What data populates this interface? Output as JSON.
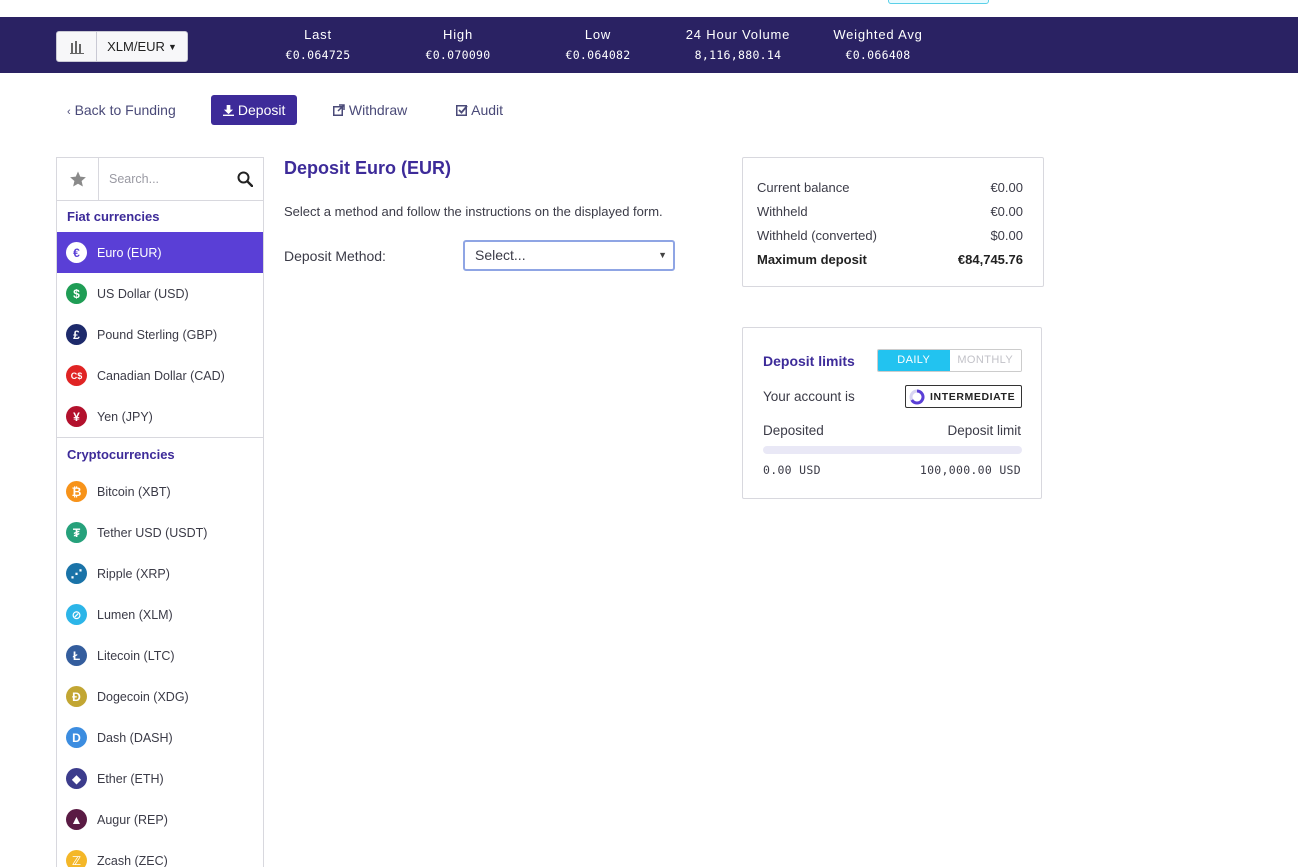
{
  "ticker": {
    "pair": "XLM/EUR",
    "stats": [
      {
        "label": "Last",
        "value": "€0.064725"
      },
      {
        "label": "High",
        "value": "€0.070090"
      },
      {
        "label": "Low",
        "value": "€0.064082"
      },
      {
        "label": "24 Hour Volume",
        "value": "8,116,880.14"
      },
      {
        "label": "Weighted Avg",
        "value": "€0.066408"
      }
    ]
  },
  "subnav": {
    "back": "Back to Funding",
    "deposit": "Deposit",
    "withdraw": "Withdraw",
    "audit": "Audit"
  },
  "sidebar": {
    "search_placeholder": "Search...",
    "fiat_heading": "Fiat currencies",
    "fiat": [
      {
        "label": "Euro (EUR)",
        "icon": "euro-icon",
        "color": "#5a3fd6",
        "glyph": "€"
      },
      {
        "label": "US Dollar (USD)",
        "icon": "dollar-icon",
        "color": "#1f9d55",
        "glyph": "$"
      },
      {
        "label": "Pound Sterling (GBP)",
        "icon": "pound-icon",
        "color": "#1d2a6b",
        "glyph": "£"
      },
      {
        "label": "Canadian Dollar (CAD)",
        "icon": "cad-icon",
        "color": "#e02424",
        "glyph": "C$"
      },
      {
        "label": "Yen (JPY)",
        "icon": "yen-icon",
        "color": "#b3112d",
        "glyph": "¥"
      }
    ],
    "crypto_heading": "Cryptocurrencies",
    "crypto": [
      {
        "label": "Bitcoin (XBT)",
        "icon": "bitcoin-icon",
        "color": "#f7931a",
        "glyph": "₿"
      },
      {
        "label": "Tether USD (USDT)",
        "icon": "tether-icon",
        "color": "#26a17b",
        "glyph": "₮"
      },
      {
        "label": "Ripple (XRP)",
        "icon": "ripple-icon",
        "color": "#1a73a8",
        "glyph": "⋰"
      },
      {
        "label": "Lumen (XLM)",
        "icon": "lumen-icon",
        "color": "#2cb5e8",
        "glyph": "⊘"
      },
      {
        "label": "Litecoin (LTC)",
        "icon": "litecoin-icon",
        "color": "#345d9d",
        "glyph": "Ł"
      },
      {
        "label": "Dogecoin (XDG)",
        "icon": "dogecoin-icon",
        "color": "#c2a633",
        "glyph": "Ð"
      },
      {
        "label": "Dash (DASH)",
        "icon": "dash-icon",
        "color": "#3c8de0",
        "glyph": "D"
      },
      {
        "label": "Ether (ETH)",
        "icon": "ether-icon",
        "color": "#3c3c8c",
        "glyph": "◆"
      },
      {
        "label": "Augur (REP)",
        "icon": "augur-icon",
        "color": "#5a1b44",
        "glyph": "▲"
      },
      {
        "label": "Zcash (ZEC)",
        "icon": "zcash-icon",
        "color": "#f4b728",
        "glyph": "ℤ"
      }
    ]
  },
  "main": {
    "title": "Deposit Euro (EUR)",
    "description": "Select a method and follow the instructions on the displayed form.",
    "method_label": "Deposit Method:",
    "method_value": "Select..."
  },
  "balance": {
    "rows": [
      {
        "label": "Current balance",
        "value": "€0.00"
      },
      {
        "label": "Withheld",
        "value": "€0.00"
      },
      {
        "label": "Withheld (converted)",
        "value": "$0.00"
      }
    ],
    "max_label": "Maximum deposit",
    "max_value": "€84,745.76"
  },
  "limits": {
    "title": "Deposit limits",
    "daily": "DAILY",
    "monthly": "MONTHLY",
    "account_label": "Your account is",
    "level": "INTERMEDIATE",
    "deposited_label": "Deposited",
    "limit_label": "Deposit limit",
    "deposited_value": "0.00 USD",
    "limit_value": "100,000.00 USD",
    "progress_fraction": 0.0
  }
}
